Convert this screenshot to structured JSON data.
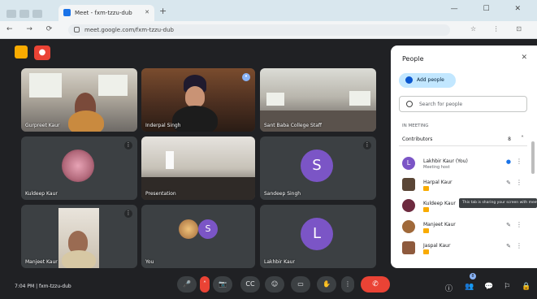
{
  "browser": {
    "tab_title": "Meet - fxm-tzzu-dub",
    "url": "meet.google.com/fxm-tzzu-dub",
    "nav_glyphs": "← → ⟳",
    "window_controls": "— ☐ ✕",
    "toolbar_glyphs": "☆ ⋮ ⊡"
  },
  "meeting": {
    "time_and_code": "7:04 PM  |  fxm-tzzu-dub",
    "tiles": [
      {
        "name": "Gurpreet Kaur"
      },
      {
        "name": "Inderpal Singh"
      },
      {
        "name": "Sant Baba College Staff"
      },
      {
        "name": "Kuldeep Kaur",
        "initial": ""
      },
      {
        "name": "Presentation"
      },
      {
        "name": "Sandeep Singh",
        "initial": "S"
      },
      {
        "name": "Manjeet Kaur"
      },
      {
        "name": "You",
        "initial": "S"
      },
      {
        "name": "Lakhbir Kaur",
        "initial": "L"
      }
    ],
    "colors": {
      "avatar_purple": "#7b55c6",
      "accent_red": "#ea4335",
      "hand_yellow": "#f9ab00"
    }
  },
  "controls": {
    "mic": "🎤",
    "cam": "📷",
    "captions": "CC",
    "emoji": "☺",
    "present": "▭",
    "hand": "✋",
    "more": "⋮",
    "end": "✆",
    "info": "ⓘ",
    "people": "👥",
    "chat": "💬",
    "activities": "⚐",
    "host": "🔒",
    "people_badge": "8"
  },
  "people_panel": {
    "title": "People",
    "close": "✕",
    "add_people_label": "Add people",
    "search_placeholder": "Search for people",
    "section_label": "IN MEETING",
    "group_label": "Contributors",
    "group_count": "8",
    "participants": [
      {
        "name": "Lakhbir Kaur (You)",
        "sub": "Meeting host",
        "initial": "L",
        "color": "#7b55c6"
      },
      {
        "name": "Harpal Kaur",
        "sub": "",
        "initial": "",
        "color": "#5a4636"
      },
      {
        "name": "Kuldeep Kaur",
        "sub": "",
        "initial": "",
        "color": "#6d2a3f"
      },
      {
        "name": "Manjeet Kaur",
        "sub": "",
        "initial": "",
        "color": "#a0693a"
      },
      {
        "name": "Jaspal Kaur",
        "sub": "",
        "initial": "",
        "color": "#8e5a3d"
      }
    ],
    "tooltip": "This tab is sharing your screen with meet.google.com"
  }
}
